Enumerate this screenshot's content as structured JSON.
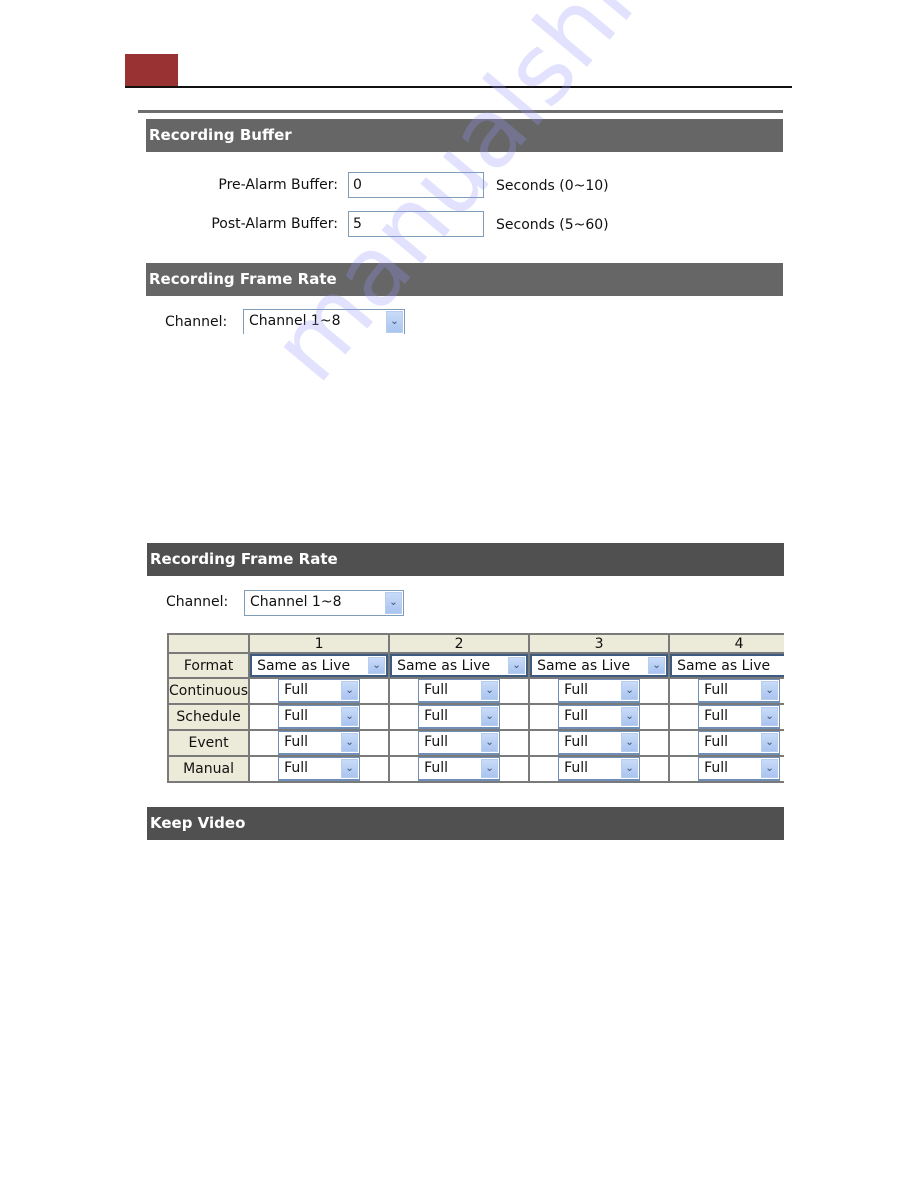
{
  "page_header": {
    "accent_color": "#993333"
  },
  "screenshot_top": {
    "recording_buffer": {
      "title": "Recording Buffer",
      "pre_alarm": {
        "label": "Pre-Alarm Buffer:",
        "value": "0",
        "unit": "Seconds (0~10)"
      },
      "post_alarm": {
        "label": "Post-Alarm Buffer:",
        "value": "5",
        "unit": "Seconds (5~60)"
      }
    },
    "recording_frame_rate": {
      "title": "Recording Frame Rate",
      "channel_label": "Channel:",
      "channel_value": "Channel 1~8"
    }
  },
  "screenshot_bottom": {
    "recording_frame_rate": {
      "title": "Recording Frame Rate",
      "channel_label": "Channel:",
      "channel_value": "Channel 1~8",
      "table": {
        "columns": [
          "",
          "1",
          "2",
          "3",
          "4"
        ],
        "rows": [
          {
            "label": "Format",
            "values": [
              "Same as Live",
              "Same as Live",
              "Same as Live",
              "Same as Live"
            ]
          },
          {
            "label": "Continuous",
            "values": [
              "Full",
              "Full",
              "Full",
              "Full"
            ]
          },
          {
            "label": "Schedule",
            "values": [
              "Full",
              "Full",
              "Full",
              "Full"
            ]
          },
          {
            "label": "Event",
            "values": [
              "Full",
              "Full",
              "Full",
              "Full"
            ]
          },
          {
            "label": "Manual",
            "values": [
              "Full",
              "Full",
              "Full",
              "Full"
            ]
          }
        ]
      }
    },
    "keep_video": {
      "title": "Keep Video"
    }
  },
  "icons": {
    "dropdown_arrow": "chevron-down-icon"
  },
  "watermark": "manualshive.com"
}
